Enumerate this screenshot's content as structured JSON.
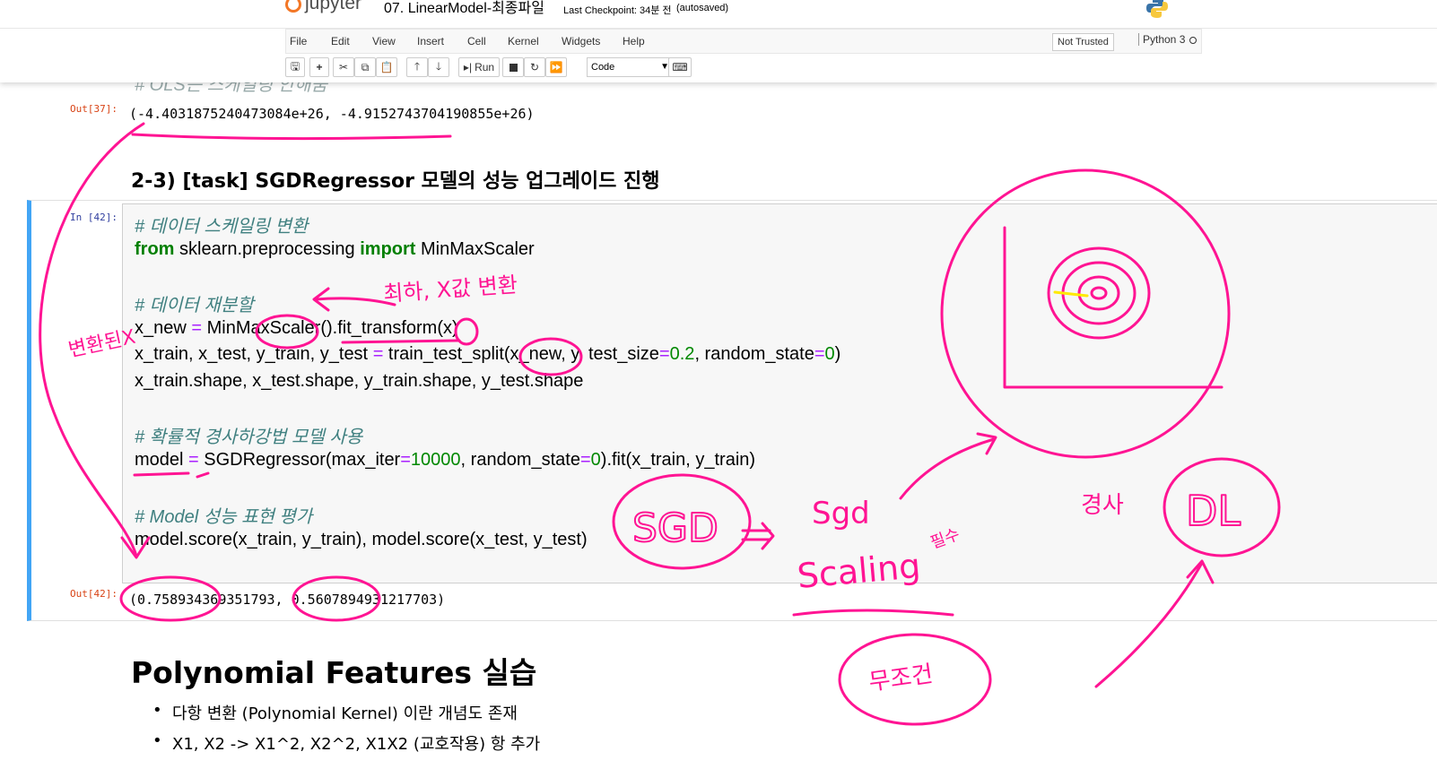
{
  "header": {
    "logo_text": "jupyter",
    "notebook_name": "07. LinearModel-최종파일",
    "checkpoint": "Last Checkpoint: 34분 전",
    "autosave": "(autosaved)"
  },
  "menu": [
    "File",
    "Edit",
    "View",
    "Insert",
    "Cell",
    "Kernel",
    "Widgets",
    "Help"
  ],
  "trust_label": "Not Trusted",
  "kernel_name": "Python 3",
  "toolbar": {
    "run_label": "Run",
    "cell_type": "Code"
  },
  "cells": {
    "prev_comment": "# OLS는 스케일링 안해줌",
    "out37_prompt": "Out[37]:",
    "out37_text": "(-4.4031875240473084e+26, -4.9152743704190855e+26)",
    "task_heading": "2-3) [task] SGDRegressor 모델의 성능 업그레이드 진행",
    "in42_prompt": "In [42]:",
    "code_comment1": "# 데이터 스케일링 변환",
    "code_from": "from",
    "code_module": " sklearn.preprocessing ",
    "code_import": "import",
    "code_class": " MinMaxScaler",
    "code_comment2": "# 데이터 재분할",
    "code_line_xnew_a": "x_new ",
    "code_line_xnew_eq": "=",
    "code_line_xnew_b": " MinMaxScaler().fit_transform(x)",
    "code_split_a": "x_train, x_test, y_train, y_test ",
    "code_split_eq": "=",
    "code_split_b": " train_test_split(x_new, y, test_size",
    "code_split_eq2": "=",
    "code_split_num": "0.2",
    "code_split_c": ", random_state",
    "code_split_eq3": "=",
    "code_split_num2": "0",
    "code_split_d": ")",
    "code_shape": "x_train.shape, x_test.shape, y_train.shape, y_test.shape",
    "code_comment3": "# 확률적 경사하강법 모델 사용",
    "code_model_a": "model ",
    "code_model_eq": "=",
    "code_model_b": " SGDRegressor(max_iter",
    "code_model_eq2": "=",
    "code_model_num": "10000",
    "code_model_c": ", random_state",
    "code_model_eq3": "=",
    "code_model_num2": "0",
    "code_model_d": ").fit(x_train, y_train)",
    "code_comment4": "# Model 성능 표현 평가",
    "code_score": "model.score(x_train, y_train), model.score(x_test, y_test)",
    "out42_prompt": "Out[42]:",
    "out42_text": "(0.758934369351793, 0.5607894931217703)",
    "poly_heading": "Polynomial Features 실습",
    "bullets": [
      "다항 변환 (Polynomial Kernel) 이란 개념도 존재",
      "X1, X2 -> X1^2, X2^2, X1X2 (교호작용) 항 추가"
    ]
  },
  "annotations": {
    "note_scale": "최하, X값 변환",
    "note_left": "변환된X",
    "note_sgd": "SGD",
    "note_sgd2": "Sgd",
    "note_scaling": "Scaling",
    "note_must": "필수",
    "note_cond": "무조건",
    "note_dl_prefix": "경사",
    "note_dl": "DL",
    "ink_color": "#ff1493"
  }
}
